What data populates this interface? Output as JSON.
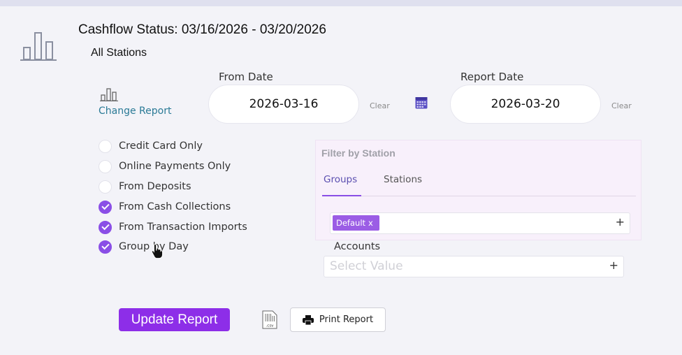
{
  "header": {
    "title": "Cashflow Status: 03/16/2026 - 03/20/2026",
    "subtitle": "All Stations"
  },
  "change_report": {
    "label": "Change Report"
  },
  "from_date": {
    "label": "From Date",
    "value": "2026-03-16",
    "clear": "Clear"
  },
  "report_date": {
    "label": "Report Date",
    "value": "2026-03-20",
    "clear": "Clear"
  },
  "options": [
    {
      "label": "Credit Card Only",
      "checked": false
    },
    {
      "label": "Online Payments Only",
      "checked": false
    },
    {
      "label": "From Deposits",
      "checked": false
    },
    {
      "label": "From Cash Collections",
      "checked": true
    },
    {
      "label": "From Transaction Imports",
      "checked": true
    },
    {
      "label": "Group by Day",
      "checked": true
    }
  ],
  "filter": {
    "title": "Filter by Station",
    "tabs": [
      {
        "label": "Groups",
        "active": true
      },
      {
        "label": "Stations",
        "active": false
      }
    ],
    "chip": {
      "label": "Default",
      "remove": "x"
    },
    "add": "+"
  },
  "accounts": {
    "label": "Accounts",
    "placeholder": "Select Value",
    "add": "+"
  },
  "actions": {
    "update": "Update Report",
    "csv_icon_label": ".csv",
    "print": "Print Report"
  },
  "colors": {
    "accent": "#8a4ee6",
    "button": "#8d2ee8",
    "link": "#2a7a96",
    "panel": "#f8f0fb"
  },
  "icons": [
    "bar-chart-icon",
    "small-bar-chart-icon",
    "calendar-icon",
    "check-icon",
    "hand-cursor-icon",
    "csv-file-icon",
    "printer-icon",
    "plus-icon"
  ]
}
